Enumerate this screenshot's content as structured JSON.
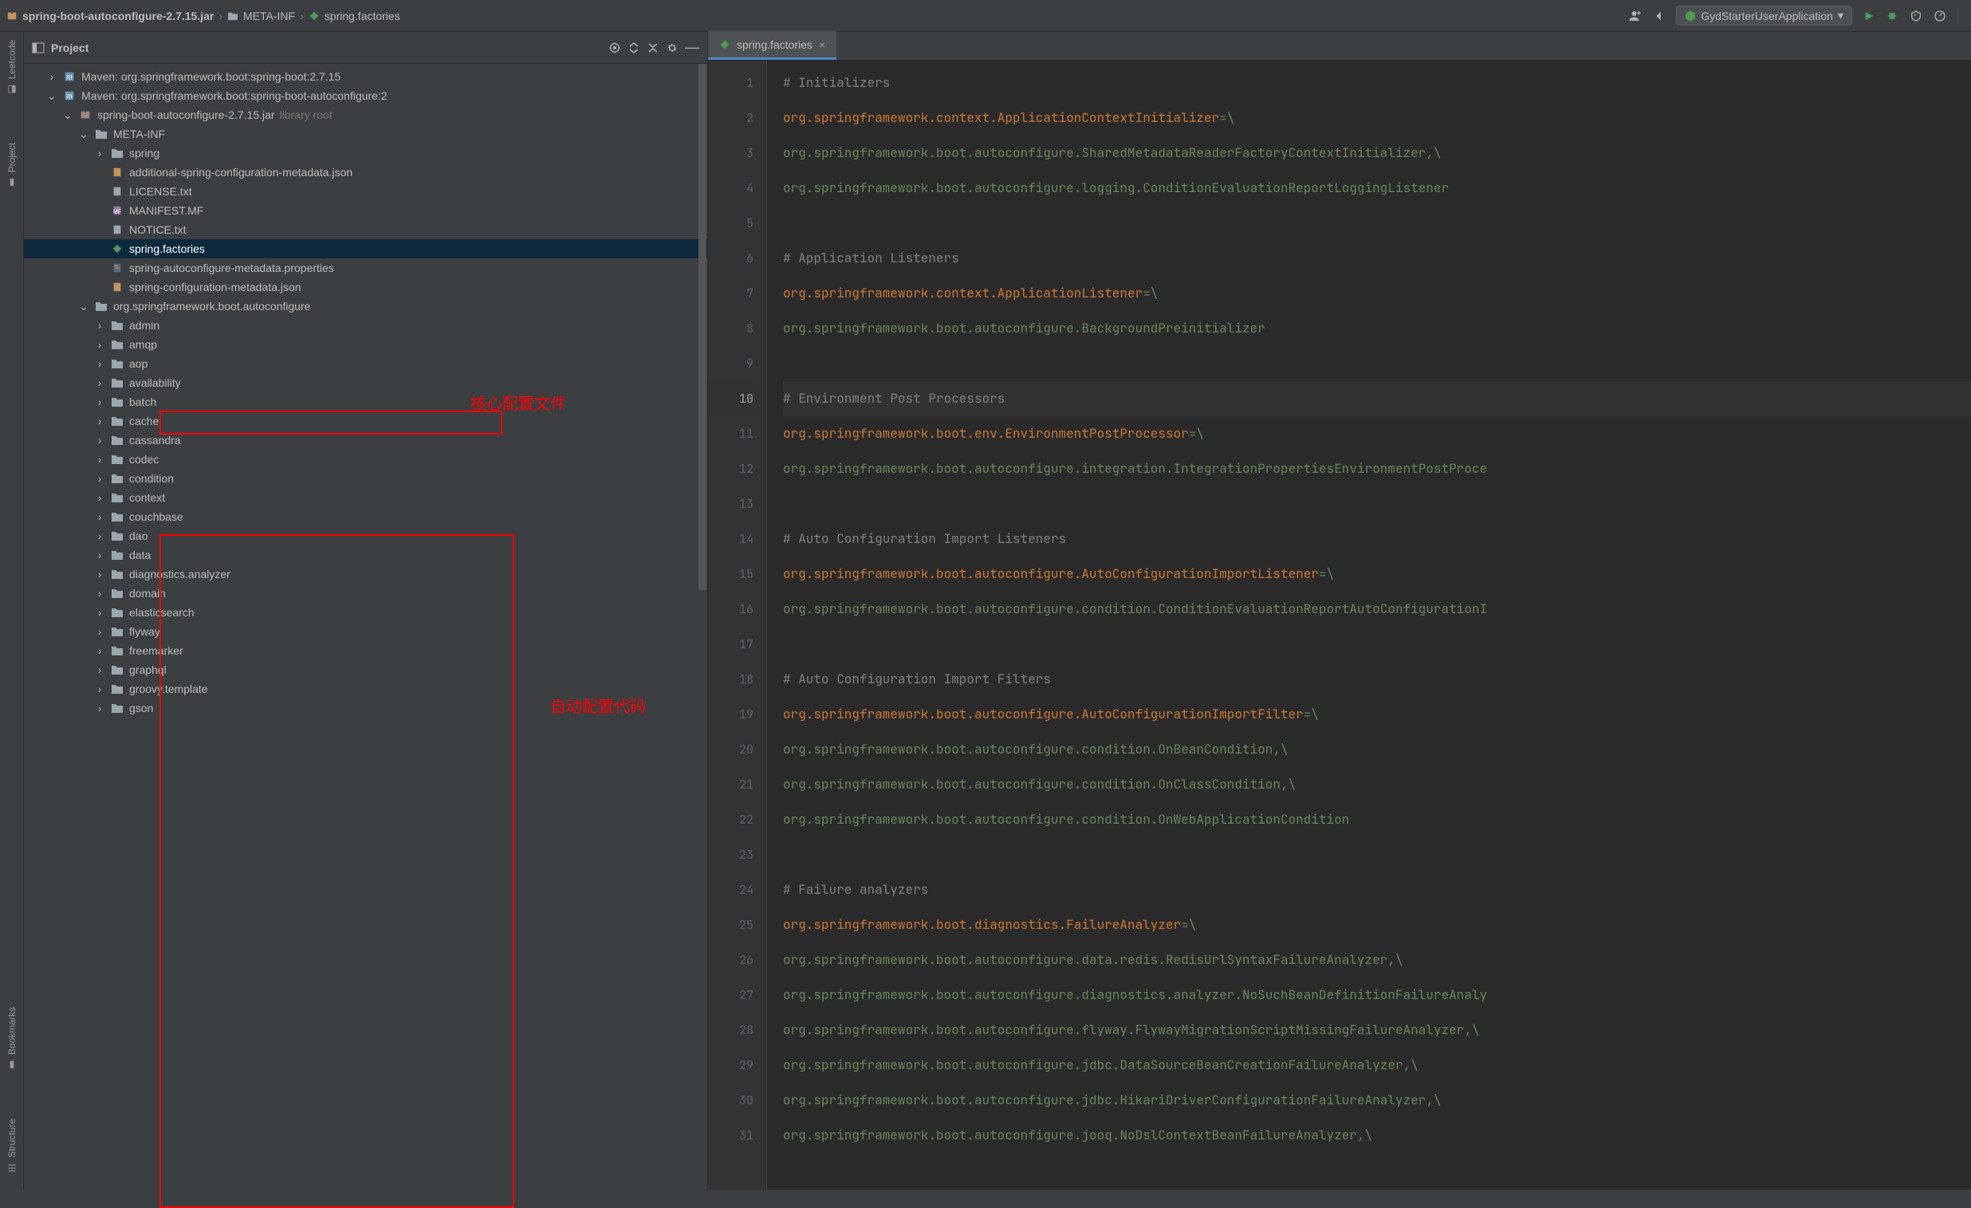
{
  "breadcrumb": {
    "crumb1": "spring-boot-autoconfigure-2.7.15.jar",
    "crumb2": "META-INF",
    "crumb3": "spring.factories"
  },
  "runConfig": {
    "label": "GydStarterUserApplication"
  },
  "leftRail": {
    "leetcode": "Leetcode",
    "project": "Project",
    "bookmarks": "Bookmarks",
    "structure": "Structure"
  },
  "projectPanel": {
    "title": "Project"
  },
  "tree": {
    "maven1": "Maven: org.springframework.boot:spring-boot:2.7.15",
    "maven2": "Maven: org.springframework.boot:spring-boot-autoconfigure:2",
    "jar": "spring-boot-autoconfigure-2.7.15.jar",
    "jarTag": "library root",
    "metaInf": "META-INF",
    "spring": "spring",
    "addJson": "additional-spring-configuration-metadata.json",
    "license": "LICENSE.txt",
    "manifest": "MANIFEST.MF",
    "notice": "NOTICE.txt",
    "factories": "spring.factories",
    "autoProps": "spring-autoconfigure-metadata.properties",
    "confJson": "spring-configuration-metadata.json",
    "pkg": "org.springframework.boot.autoconfigure",
    "folders": [
      "admin",
      "amqp",
      "aop",
      "availability",
      "batch",
      "cache",
      "cassandra",
      "codec",
      "condition",
      "context",
      "couchbase",
      "dao",
      "data",
      "diagnostics.analyzer",
      "domain",
      "elasticsearch",
      "flyway",
      "freemarker",
      "graphql",
      "groovy.template",
      "gson"
    ]
  },
  "annotations": {
    "coreConfig": "核心配置文件",
    "autoConfigCode": "自动配置代码"
  },
  "editor": {
    "tab": "spring.factories",
    "lines": [
      {
        "n": 1,
        "t": "comment",
        "text": "# Initializers"
      },
      {
        "n": 2,
        "t": "kv",
        "key": "org.springframework.context.ApplicationContextInitializer",
        "sep": "=\\"
      },
      {
        "n": 3,
        "t": "val",
        "text": "org.springframework.boot.autoconfigure.SharedMetadataReaderFactoryContextInitializer,\\"
      },
      {
        "n": 4,
        "t": "val",
        "text": "org.springframework.boot.autoconfigure.logging.ConditionEvaluationReportLoggingListener"
      },
      {
        "n": 5,
        "t": "blank",
        "text": ""
      },
      {
        "n": 6,
        "t": "comment",
        "text": "# Application Listeners"
      },
      {
        "n": 7,
        "t": "kv",
        "key": "org.springframework.context.ApplicationListener",
        "sep": "=\\"
      },
      {
        "n": 8,
        "t": "val",
        "text": "org.springframework.boot.autoconfigure.BackgroundPreinitializer"
      },
      {
        "n": 9,
        "t": "blank",
        "text": ""
      },
      {
        "n": 10,
        "t": "comment",
        "hl": true,
        "text": "# Environment Post Processors"
      },
      {
        "n": 11,
        "t": "kv",
        "key": "org.springframework.boot.env.EnvironmentPostProcessor",
        "sep": "=\\"
      },
      {
        "n": 12,
        "t": "val",
        "text": "org.springframework.boot.autoconfigure.integration.IntegrationPropertiesEnvironmentPostProce"
      },
      {
        "n": 13,
        "t": "blank",
        "text": ""
      },
      {
        "n": 14,
        "t": "comment",
        "text": "# Auto Configuration Import Listeners"
      },
      {
        "n": 15,
        "t": "kv",
        "key": "org.springframework.boot.autoconfigure.AutoConfigurationImportListener",
        "sep": "=\\"
      },
      {
        "n": 16,
        "t": "val",
        "text": "org.springframework.boot.autoconfigure.condition.ConditionEvaluationReportAutoConfigurationI"
      },
      {
        "n": 17,
        "t": "blank",
        "text": ""
      },
      {
        "n": 18,
        "t": "comment",
        "text": "# Auto Configuration Import Filters"
      },
      {
        "n": 19,
        "t": "kv",
        "key": "org.springframework.boot.autoconfigure.AutoConfigurationImportFilter",
        "sep": "=\\"
      },
      {
        "n": 20,
        "t": "val",
        "text": "org.springframework.boot.autoconfigure.condition.OnBeanCondition,\\"
      },
      {
        "n": 21,
        "t": "val",
        "text": "org.springframework.boot.autoconfigure.condition.OnClassCondition,\\"
      },
      {
        "n": 22,
        "t": "val",
        "text": "org.springframework.boot.autoconfigure.condition.OnWebApplicationCondition"
      },
      {
        "n": 23,
        "t": "blank",
        "text": ""
      },
      {
        "n": 24,
        "t": "comment",
        "text": "# Failure analyzers"
      },
      {
        "n": 25,
        "t": "kv",
        "key": "org.springframework.boot.diagnostics.FailureAnalyzer",
        "sep": "=\\"
      },
      {
        "n": 26,
        "t": "val",
        "text": "org.springframework.boot.autoconfigure.data.redis.RedisUrlSyntaxFailureAnalyzer,\\"
      },
      {
        "n": 27,
        "t": "val",
        "text": "org.springframework.boot.autoconfigure.diagnostics.analyzer.NoSuchBeanDefinitionFailureAnaly"
      },
      {
        "n": 28,
        "t": "val",
        "text": "org.springframework.boot.autoconfigure.flyway.FlywayMigrationScriptMissingFailureAnalyzer,\\"
      },
      {
        "n": 29,
        "t": "val",
        "text": "org.springframework.boot.autoconfigure.jdbc.DataSourceBeanCreationFailureAnalyzer,\\"
      },
      {
        "n": 30,
        "t": "val",
        "text": "org.springframework.boot.autoconfigure.jdbc.HikariDriverConfigurationFailureAnalyzer,\\"
      },
      {
        "n": 31,
        "t": "val",
        "text": "org.springframework.boot.autoconfigure.jooq.NoDslContextBeanFailureAnalyzer,\\"
      }
    ]
  }
}
